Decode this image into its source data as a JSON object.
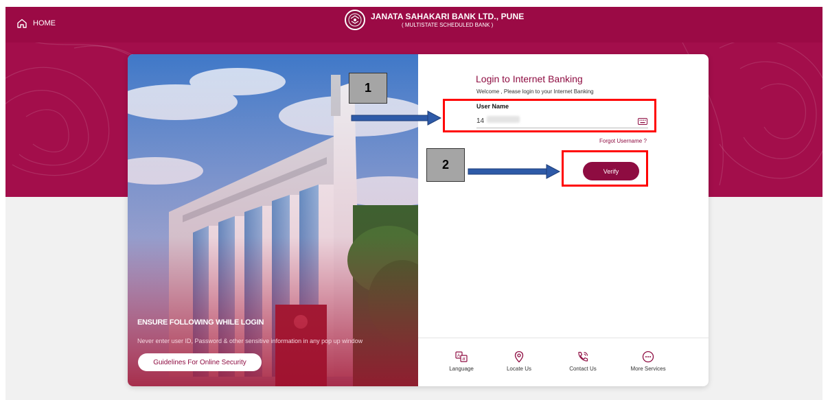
{
  "header": {
    "home_label": "HOME",
    "bank_name": "JANATA SAHAKARI BANK LTD., PUNE",
    "bank_subtitle": "( MULTISTATE SCHEDULED BANK )"
  },
  "hero": {
    "title": "ENSURE FOLLOWING WHILE LOGIN",
    "note": "Never enter user ID, Password & other sensitive information in any pop up window",
    "button_label": "Guidelines For Online Security"
  },
  "login": {
    "title": "Login to Internet Banking",
    "subtitle": "Welcome , Please login to your Internet Banking",
    "username_label": "User Name",
    "username_value": "14",
    "forgot_label": "Forgot Username ?",
    "verify_label": "Verify"
  },
  "services": [
    {
      "label": "Language",
      "icon": "language-icon"
    },
    {
      "label": "Locate Us",
      "icon": "location-pin-icon"
    },
    {
      "label": "Contact Us",
      "icon": "phone-icon"
    },
    {
      "label": "More Services",
      "icon": "more-icon"
    }
  ],
  "annotations": {
    "step1": "1",
    "step2": "2"
  },
  "colors": {
    "brand": "#9b0a45",
    "accent": "#8e0c41",
    "annotation": "#ff0000",
    "arrow": "#2e5aa8"
  }
}
